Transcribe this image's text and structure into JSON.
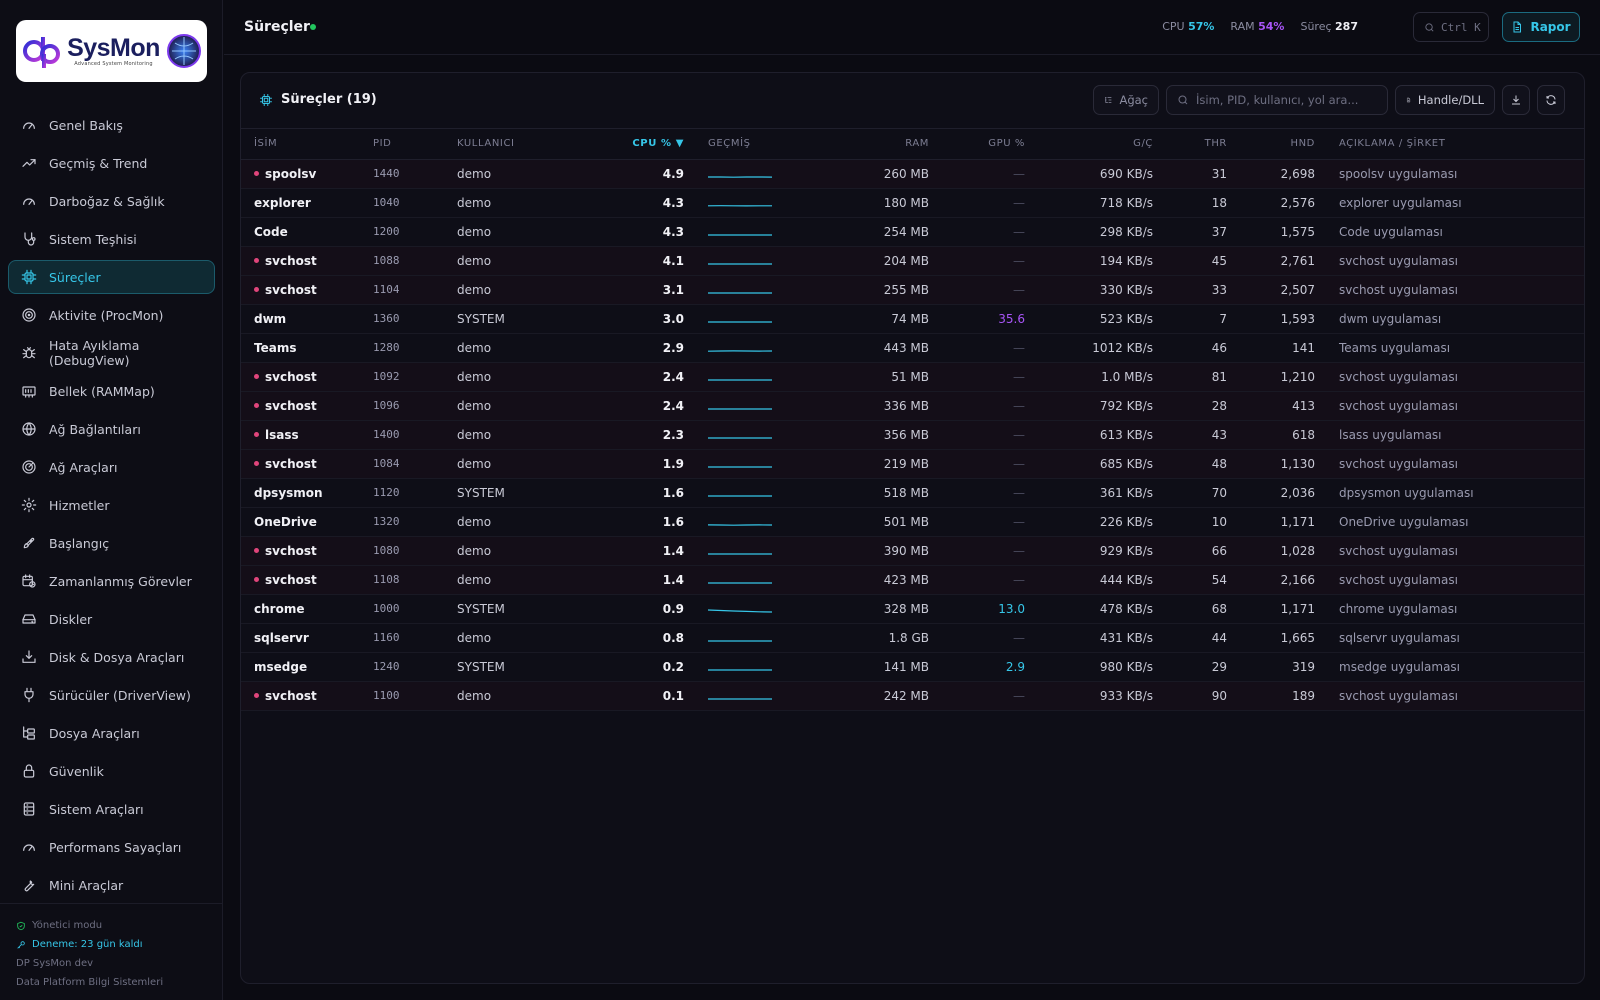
{
  "logo": {
    "brand": "SysMon",
    "tagline": "Advanced System Monitoring"
  },
  "sidebar": {
    "items": [
      {
        "label": "Genel Bakış",
        "icon": "gauge-icon"
      },
      {
        "label": "Geçmiş & Trend",
        "icon": "trend-up-icon"
      },
      {
        "label": "Darboğaz & Sağlık",
        "icon": "gauge-icon"
      },
      {
        "label": "Sistem Teşhisi",
        "icon": "stethoscope-icon"
      },
      {
        "label": "Süreçler",
        "icon": "cpu-icon",
        "active": true
      },
      {
        "label": "Aktivite (ProcMon)",
        "icon": "radar-icon"
      },
      {
        "label": "Hata Ayıklama (DebugView)",
        "icon": "bug-icon"
      },
      {
        "label": "Bellek (RAMMap)",
        "icon": "memory-icon"
      },
      {
        "label": "Ağ Bağlantıları",
        "icon": "globe-icon"
      },
      {
        "label": "Ağ Araçları",
        "icon": "radar-icon"
      },
      {
        "label": "Hizmetler",
        "icon": "gear-icon"
      },
      {
        "label": "Başlangıç",
        "icon": "rocket-icon"
      },
      {
        "label": "Zamanlanmış Görevler",
        "icon": "calendar-clock-icon"
      },
      {
        "label": "Diskler",
        "icon": "hard-drive-icon"
      },
      {
        "label": "Disk & Dosya Araçları",
        "icon": "download-tray-icon"
      },
      {
        "label": "Sürücüler (DriverView)",
        "icon": "plug-icon"
      },
      {
        "label": "Dosya Araçları",
        "icon": "folder-tree-icon"
      },
      {
        "label": "Güvenlik",
        "icon": "lock-icon"
      },
      {
        "label": "Sistem Araçları",
        "icon": "server-icon"
      },
      {
        "label": "Performans Sayaçları",
        "icon": "gauge-icon"
      },
      {
        "label": "Mini Araçlar",
        "icon": "wrench-icon"
      }
    ],
    "footer": {
      "admin": "Yönetici modu",
      "trial": "Deneme: 23 gün kaldı",
      "product": "DP SysMon dev",
      "company": "Data Platform Bilgi Sistemleri"
    }
  },
  "header": {
    "title": "Süreçler",
    "stats": {
      "cpu_label": "CPU",
      "cpu_value": "57%",
      "ram_label": "RAM",
      "ram_value": "54%",
      "proc_label": "Süreç",
      "proc_value": "287"
    },
    "shortcut": "Ctrl K",
    "report_button": "Rapor"
  },
  "panel": {
    "title": "Süreçler (19)",
    "tree_button": "Ağaç",
    "search_placeholder": "İsim, PID, kullanıcı, yol ara...",
    "handle_button": "Handle/DLL",
    "columns": {
      "name": "İSİM",
      "pid": "PID",
      "user": "KULLANICI",
      "cpu": "CPU % ▼",
      "history": "GEÇMİŞ",
      "ram": "RAM",
      "gpu": "GPU %",
      "io": "G/Ç",
      "thr": "THR",
      "hnd": "HND",
      "desc": "AÇIKLAMA / ŞİRKET"
    },
    "rows": [
      {
        "name": "spoolsv",
        "svc": true,
        "pid": "1440",
        "user": "demo",
        "cpu": "4.9",
        "ram": "260 MB",
        "gpu": "—",
        "io": "690 KB/s",
        "thr": "31",
        "hnd": "2,698",
        "desc": "spoolsv uygulaması",
        "spark": [
          0.3,
          0.3,
          0.28,
          0.3,
          0.3,
          0.29
        ]
      },
      {
        "name": "explorer",
        "svc": false,
        "pid": "1040",
        "user": "demo",
        "cpu": "4.3",
        "ram": "180 MB",
        "gpu": "—",
        "io": "718 KB/s",
        "thr": "18",
        "hnd": "2,576",
        "desc": "explorer uygulaması",
        "spark": [
          0.32,
          0.33,
          0.32,
          0.31,
          0.32,
          0.32
        ]
      },
      {
        "name": "Code",
        "svc": false,
        "pid": "1200",
        "user": "demo",
        "cpu": "4.3",
        "ram": "254 MB",
        "gpu": "—",
        "io": "298 KB/s",
        "thr": "37",
        "hnd": "1,575",
        "desc": "Code uygulaması",
        "spark": [
          0.3,
          0.3,
          0.3,
          0.3,
          0.3,
          0.3
        ]
      },
      {
        "name": "svchost",
        "svc": true,
        "pid": "1088",
        "user": "demo",
        "cpu": "4.1",
        "ram": "204 MB",
        "gpu": "—",
        "io": "194 KB/s",
        "thr": "45",
        "hnd": "2,761",
        "desc": "svchost uygulaması",
        "spark": [
          0.3,
          0.3,
          0.3,
          0.3,
          0.3,
          0.3
        ]
      },
      {
        "name": "svchost",
        "svc": true,
        "pid": "1104",
        "user": "demo",
        "cpu": "3.1",
        "ram": "255 MB",
        "gpu": "—",
        "io": "330 KB/s",
        "thr": "33",
        "hnd": "2,507",
        "desc": "svchost uygulaması",
        "spark": [
          0.3,
          0.3,
          0.3,
          0.3,
          0.3,
          0.3
        ]
      },
      {
        "name": "dwm",
        "svc": false,
        "pid": "1360",
        "user": "SYSTEM",
        "cpu": "3.0",
        "ram": "74 MB",
        "gpu": "35.6",
        "gpu_level": "hi",
        "io": "523 KB/s",
        "thr": "7",
        "hnd": "1,593",
        "desc": "dwm uygulaması",
        "spark": [
          0.3,
          0.3,
          0.3,
          0.3,
          0.3,
          0.3
        ]
      },
      {
        "name": "Teams",
        "svc": false,
        "pid": "1280",
        "user": "demo",
        "cpu": "2.9",
        "ram": "443 MB",
        "gpu": "—",
        "io": "1012 KB/s",
        "thr": "46",
        "hnd": "141",
        "desc": "Teams uygulaması",
        "spark": [
          0.28,
          0.3,
          0.31,
          0.3,
          0.29,
          0.3
        ]
      },
      {
        "name": "svchost",
        "svc": true,
        "pid": "1092",
        "user": "demo",
        "cpu": "2.4",
        "ram": "51 MB",
        "gpu": "—",
        "io": "1.0 MB/s",
        "thr": "81",
        "hnd": "1,210",
        "desc": "svchost uygulaması",
        "spark": [
          0.3,
          0.3,
          0.3,
          0.3,
          0.3,
          0.3
        ]
      },
      {
        "name": "svchost",
        "svc": true,
        "pid": "1096",
        "user": "demo",
        "cpu": "2.4",
        "ram": "336 MB",
        "gpu": "—",
        "io": "792 KB/s",
        "thr": "28",
        "hnd": "413",
        "desc": "svchost uygulaması",
        "spark": [
          0.3,
          0.3,
          0.3,
          0.3,
          0.3,
          0.3
        ]
      },
      {
        "name": "lsass",
        "svc": true,
        "pid": "1400",
        "user": "demo",
        "cpu": "2.3",
        "ram": "356 MB",
        "gpu": "—",
        "io": "613 KB/s",
        "thr": "43",
        "hnd": "618",
        "desc": "lsass uygulaması",
        "spark": [
          0.3,
          0.3,
          0.3,
          0.3,
          0.3,
          0.3
        ]
      },
      {
        "name": "svchost",
        "svc": true,
        "pid": "1084",
        "user": "demo",
        "cpu": "1.9",
        "ram": "219 MB",
        "gpu": "—",
        "io": "685 KB/s",
        "thr": "48",
        "hnd": "1,130",
        "desc": "svchost uygulaması",
        "spark": [
          0.3,
          0.3,
          0.3,
          0.3,
          0.3,
          0.3
        ]
      },
      {
        "name": "dpsysmon",
        "svc": false,
        "pid": "1120",
        "user": "SYSTEM",
        "cpu": "1.6",
        "ram": "518 MB",
        "gpu": "—",
        "io": "361 KB/s",
        "thr": "70",
        "hnd": "2,036",
        "desc": "dpsysmon uygulaması",
        "spark": [
          0.3,
          0.3,
          0.3,
          0.3,
          0.3,
          0.3
        ]
      },
      {
        "name": "OneDrive",
        "svc": false,
        "pid": "1320",
        "user": "demo",
        "cpu": "1.6",
        "ram": "501 MB",
        "gpu": "—",
        "io": "226 KB/s",
        "thr": "10",
        "hnd": "1,171",
        "desc": "OneDrive uygulaması",
        "spark": [
          0.31,
          0.3,
          0.28,
          0.3,
          0.31,
          0.3
        ]
      },
      {
        "name": "svchost",
        "svc": true,
        "pid": "1080",
        "user": "demo",
        "cpu": "1.4",
        "ram": "390 MB",
        "gpu": "—",
        "io": "929 KB/s",
        "thr": "66",
        "hnd": "1,028",
        "desc": "svchost uygulaması",
        "spark": [
          0.3,
          0.3,
          0.3,
          0.3,
          0.3,
          0.3
        ]
      },
      {
        "name": "svchost",
        "svc": true,
        "pid": "1108",
        "user": "demo",
        "cpu": "1.4",
        "ram": "423 MB",
        "gpu": "—",
        "io": "444 KB/s",
        "thr": "54",
        "hnd": "2,166",
        "desc": "svchost uygulaması",
        "spark": [
          0.3,
          0.3,
          0.3,
          0.3,
          0.3,
          0.3
        ]
      },
      {
        "name": "chrome",
        "svc": false,
        "pid": "1000",
        "user": "SYSTEM",
        "cpu": "0.9",
        "ram": "328 MB",
        "gpu": "13.0",
        "gpu_level": "mid",
        "io": "478 KB/s",
        "thr": "68",
        "hnd": "1,171",
        "desc": "chrome uygulaması",
        "spark": [
          0.5,
          0.45,
          0.4,
          0.36,
          0.32,
          0.3
        ]
      },
      {
        "name": "sqlservr",
        "svc": false,
        "pid": "1160",
        "user": "demo",
        "cpu": "0.8",
        "ram": "1.8 GB",
        "gpu": "—",
        "io": "431 KB/s",
        "thr": "44",
        "hnd": "1,665",
        "desc": "sqlservr uygulaması",
        "spark": [
          0.3,
          0.3,
          0.3,
          0.3,
          0.3,
          0.3
        ]
      },
      {
        "name": "msedge",
        "svc": false,
        "pid": "1240",
        "user": "SYSTEM",
        "cpu": "0.2",
        "ram": "141 MB",
        "gpu": "2.9",
        "gpu_level": "mid",
        "io": "980 KB/s",
        "thr": "29",
        "hnd": "319",
        "desc": "msedge uygulaması",
        "spark": [
          0.3,
          0.3,
          0.3,
          0.3,
          0.3,
          0.3
        ]
      },
      {
        "name": "svchost",
        "svc": true,
        "pid": "1100",
        "user": "demo",
        "cpu": "0.1",
        "ram": "242 MB",
        "gpu": "—",
        "io": "933 KB/s",
        "thr": "90",
        "hnd": "189",
        "desc": "svchost uygulaması",
        "spark": [
          0.3,
          0.3,
          0.3,
          0.3,
          0.3,
          0.3
        ]
      }
    ]
  },
  "colors": {
    "accent": "#36c6e8",
    "purple": "#a855f7",
    "service_dot": "#e0457b",
    "ok": "#22c55e"
  }
}
